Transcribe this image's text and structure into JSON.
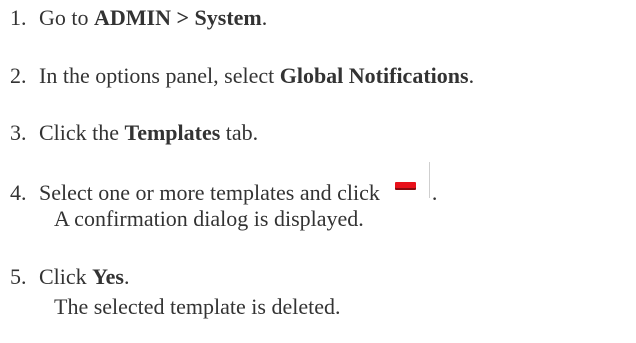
{
  "steps": [
    {
      "num": "1.",
      "pre": "Go to ",
      "bold": "ADMIN > System",
      "post": "."
    },
    {
      "num": "2.",
      "pre": "In the options panel, select ",
      "bold": "Global Notifications",
      "post": "."
    },
    {
      "num": "3.",
      "pre": "Click the ",
      "bold": "Templates",
      "post": " tab."
    },
    {
      "num": "4.",
      "pre": "Select one or more templates and click",
      "post": ".",
      "icon": "minus-icon",
      "sub": "A confirmation dialog is displayed."
    },
    {
      "num": "5.",
      "pre": "Click ",
      "bold": "Yes",
      "post": ".",
      "sub": "The selected template is deleted."
    }
  ],
  "colors": {
    "text": "#333333",
    "delete_icon": "#e8101a"
  }
}
